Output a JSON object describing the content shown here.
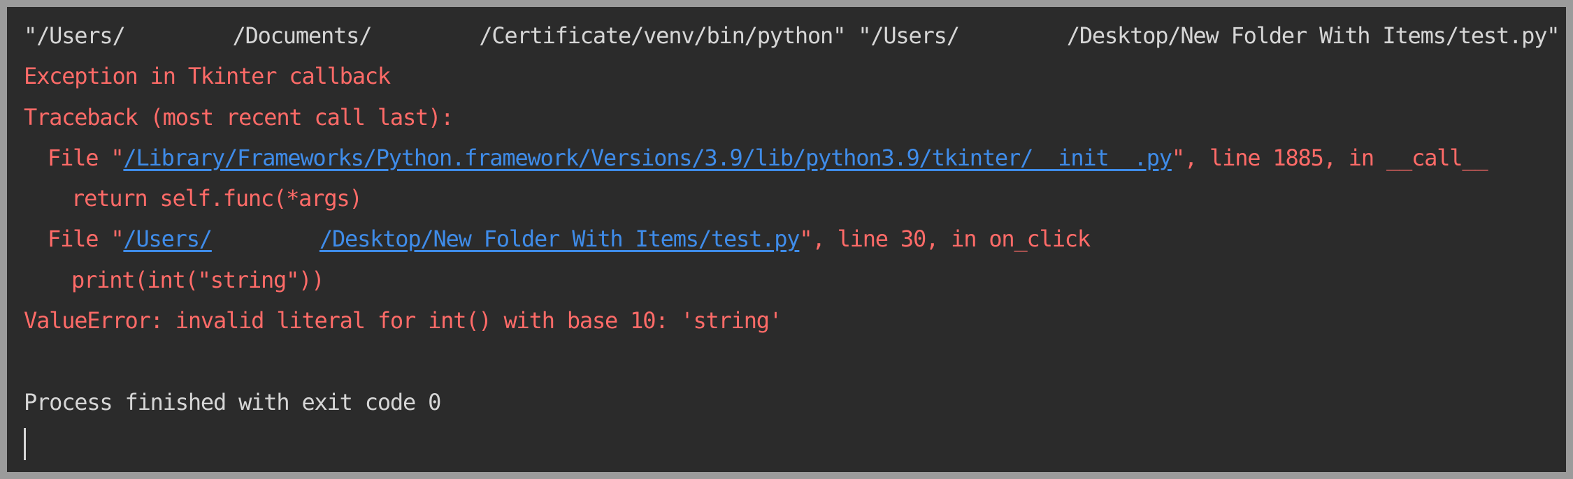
{
  "command": {
    "part1": "\"/Users/",
    "part2": "/Documents/",
    "part3": "/Certificate/venv/bin/python\" \"/Users/",
    "part4": "/Desktop/New Folder With Items/test.py\""
  },
  "traceback": {
    "exception_line": "Exception in Tkinter callback",
    "header_line": "Traceback (most recent call last):",
    "frame1": {
      "prefix": "File \"",
      "link": "/Library/Frameworks/Python.framework/Versions/3.9/lib/python3.9/tkinter/__init__.py",
      "suffix": "\", line 1885, in __call__",
      "code": "return self.func(*args)"
    },
    "frame2": {
      "prefix": "File \"",
      "link_part1": "/Users/",
      "link_part2": "/Desktop/New Folder With Items/test.py",
      "suffix": "\", line 30, in on_click",
      "code": "print(int(\"string\"))"
    },
    "error_line": "ValueError: invalid literal for int() with base 10: 'string'"
  },
  "process_finished": "Process finished with exit code 0",
  "colors": {
    "background": "#2b2b2b",
    "frame": "#9b9b9b",
    "plain_text": "#d6d6d6",
    "error_text": "#ff6b68",
    "link": "#3f8ce9"
  }
}
